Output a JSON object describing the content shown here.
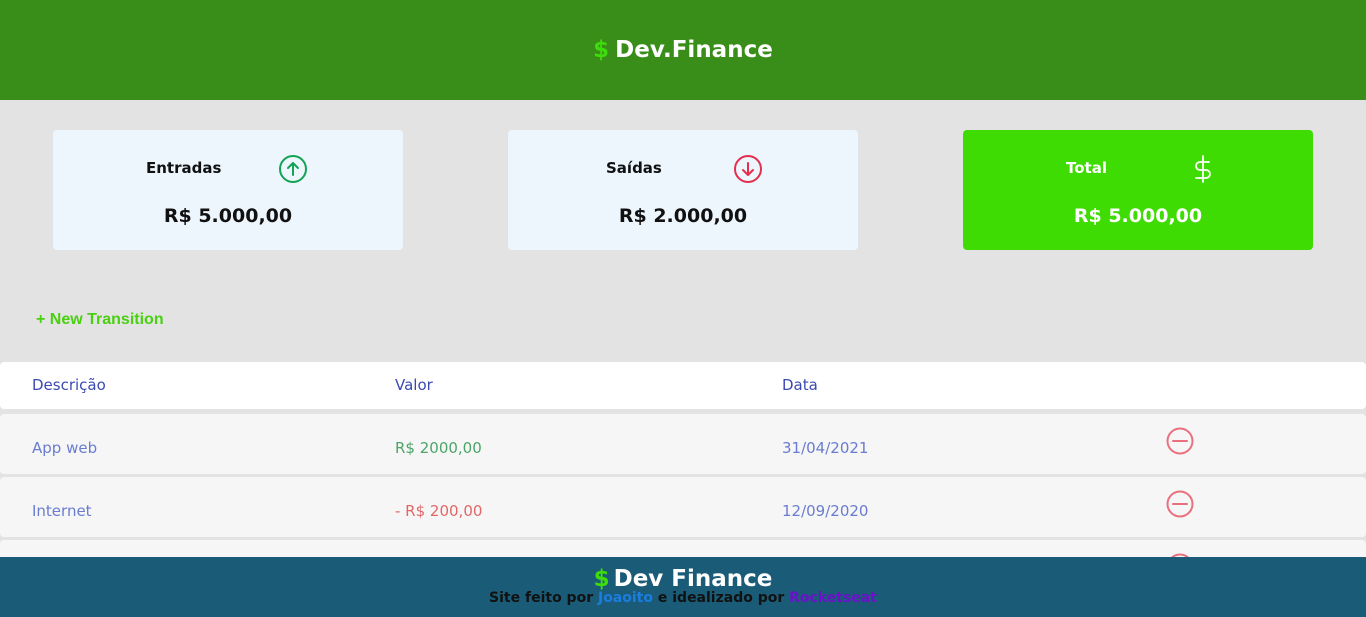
{
  "header": {
    "currency_symbol": "$",
    "title": "Dev.Finance"
  },
  "cards": [
    {
      "title": "Entradas",
      "value": "R$ 5.000,00",
      "icon": "arrow-up-circle-icon"
    },
    {
      "title": "Saídas",
      "value": "R$ 2.000,00",
      "icon": "arrow-down-circle-icon"
    },
    {
      "title": "Total",
      "value": "R$ 5.000,00",
      "icon": "dollar-sign-icon"
    }
  ],
  "actions": {
    "new_transaction": "+ New Transition"
  },
  "table": {
    "headers": [
      "Descrição",
      "Valor",
      "Data"
    ],
    "rows": [
      {
        "description": "App web",
        "amount": "R$ 2000,00",
        "date": "31/04/2021"
      },
      {
        "description": "Internet",
        "amount": "- R$ 200,00",
        "date": "12/09/2020"
      }
    ]
  },
  "footer": {
    "currency_symbol": "$",
    "title": "Dev Finance",
    "credit_prefix": "Site feito por",
    "author": "Joaoito",
    "credit_middle": "e idealizado por",
    "org": "Rocketseat"
  },
  "colors": {
    "header_bg": "#388e18",
    "accent_green": "#3fdc04",
    "footer_bg": "#1a5c78",
    "income": "#4ca46a",
    "expense": "#e16767"
  }
}
